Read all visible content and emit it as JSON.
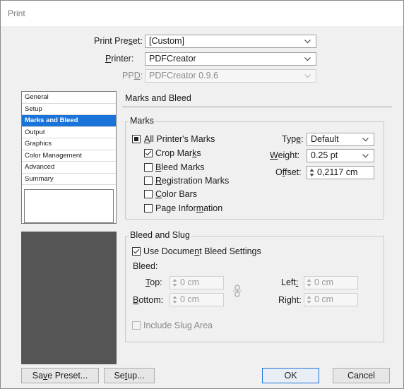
{
  "title": "Print",
  "top": {
    "preset_label_pre": "Print Pre",
    "preset_label_u": "s",
    "preset_label_post": "et:",
    "preset_value": "[Custom]",
    "printer_label_u": "P",
    "printer_label_post": "rinter:",
    "printer_value": "PDFCreator",
    "ppd_label_pre": "PP",
    "ppd_label_u": "D",
    "ppd_label_post": ":",
    "ppd_value": "PDFCreator 0.9.6"
  },
  "nav": {
    "items": [
      "General",
      "Setup",
      "Marks and Bleed",
      "Output",
      "Graphics",
      "Color Management",
      "Advanced",
      "Summary"
    ],
    "selected": "Marks and Bleed"
  },
  "section_title": "Marks and Bleed",
  "marks": {
    "title": "Marks",
    "all_printers_u": "A",
    "all_printers_post": "ll Printer's Marks",
    "crop_pre": "Crop Mar",
    "crop_u": "k",
    "crop_post": "s",
    "bleed_u": "B",
    "bleed_post": "leed Marks",
    "registration_u": "R",
    "registration_post": "egistration Marks",
    "color_u": "C",
    "color_post": "olor Bars",
    "page_pre": "Page Infor",
    "page_u": "m",
    "page_post": "ation",
    "type_pre": "Typ",
    "type_u": "e",
    "type_post": ":",
    "type_value": "Default",
    "weight_u": "W",
    "weight_post": "eight:",
    "weight_value": "0.25 pt",
    "offset_pre": "O",
    "offset_u": "f",
    "offset_post": "fset:",
    "offset_value": "0,2117 cm"
  },
  "bleed": {
    "title": "Bleed and Slug",
    "use_doc_pre": "Use Docume",
    "use_doc_u": "n",
    "use_doc_post": "t Bleed Settings",
    "bleed_label": "Bleed:",
    "top_u": "T",
    "top_post": "op:",
    "top_value": "0 cm",
    "bottom_u": "B",
    "bottom_post": "ottom:",
    "bottom_value": "0 cm",
    "left_pre": "Left",
    "left_u": ":",
    "left_value": "0 cm",
    "right_pre": "Ri",
    "right_u": "g",
    "right_post": "ht:",
    "right_value": "0 cm",
    "slug_pre": "Include Slu",
    "slug_u": "g",
    "slug_post": " Area"
  },
  "buttons": {
    "save_pre": "Sa",
    "save_u": "v",
    "save_post": "e Preset...",
    "setup_pre": "Se",
    "setup_u": "t",
    "setup_post": "up...",
    "ok": "OK",
    "cancel": "Cancel"
  }
}
